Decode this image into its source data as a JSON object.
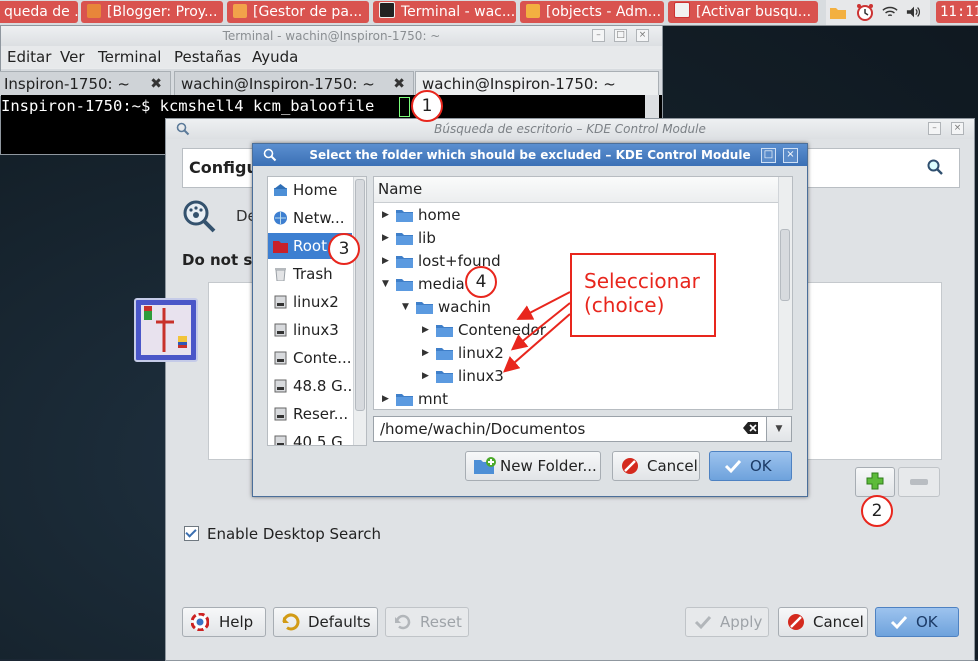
{
  "taskbar": {
    "tasks": [
      {
        "label": "queda de ...",
        "icon": "browser-icon"
      },
      {
        "label": "[Blogger: Proy...",
        "icon": "blogger-icon"
      },
      {
        "label": "[Gestor de pa...",
        "icon": "package-manager-icon"
      },
      {
        "label": "Terminal - wac...",
        "icon": "terminal-icon"
      },
      {
        "label": "[objects - Adm...",
        "icon": "folder-icon"
      },
      {
        "label": "[Activar busqu...",
        "icon": "document-icon"
      }
    ],
    "clock": "11:11",
    "tray_icons": [
      "folder-icon",
      "alarm-clock-icon",
      "wifi-icon",
      "volume-icon"
    ]
  },
  "terminal": {
    "title": "Terminal - wachin@Inspiron-1750: ~",
    "menu": [
      "Editar",
      "Ver",
      "Terminal",
      "Pestañas",
      "Ayuda"
    ],
    "tabs": [
      "Inspiron-1750: ~",
      "wachin@Inspiron-1750: ~",
      "wachin@Inspiron-1750: ~"
    ],
    "prompt": "Inspiron-1750:~$ ",
    "command": "kcmshell4 kcm_baloofile"
  },
  "kcm": {
    "title": "Búsqueda de escritorio – KDE Control Module",
    "header": "Configur",
    "description": "De",
    "do_not_search": "Do not se",
    "enable_search": "Enable Desktop Search",
    "buttons": {
      "help": "Help",
      "defaults": "Defaults",
      "reset": "Reset",
      "apply": "Apply",
      "cancel": "Cancel",
      "ok": "OK"
    }
  },
  "dialog": {
    "title": "Select the folder which should be excluded – KDE Control Module",
    "places": [
      {
        "label": "Home",
        "icon": "home-icon",
        "selected": false
      },
      {
        "label": "Netw...",
        "icon": "network-icon",
        "selected": false
      },
      {
        "label": "Root",
        "icon": "root-folder-icon",
        "selected": true
      },
      {
        "label": "Trash",
        "icon": "trash-icon",
        "selected": false
      },
      {
        "label": "linux2",
        "icon": "drive-icon",
        "selected": false
      },
      {
        "label": "linux3",
        "icon": "drive-icon",
        "selected": false
      },
      {
        "label": "Conte...",
        "icon": "drive-icon",
        "selected": false
      },
      {
        "label": "48.8 G...",
        "icon": "drive-icon",
        "selected": false
      },
      {
        "label": "Reser...",
        "icon": "drive-icon",
        "selected": false
      },
      {
        "label": "40.5 G...",
        "icon": "drive-icon",
        "selected": false
      }
    ],
    "tree_header": "Name",
    "tree": [
      {
        "label": "home",
        "depth": 0,
        "expanded": false
      },
      {
        "label": "lib",
        "depth": 0,
        "expanded": false
      },
      {
        "label": "lost+found",
        "depth": 0,
        "expanded": false
      },
      {
        "label": "media",
        "depth": 0,
        "expanded": true
      },
      {
        "label": "wachin",
        "depth": 1,
        "expanded": true
      },
      {
        "label": "Contenedor",
        "depth": 2,
        "expanded": false
      },
      {
        "label": "linux2",
        "depth": 2,
        "expanded": false
      },
      {
        "label": "linux3",
        "depth": 2,
        "expanded": false
      },
      {
        "label": "mnt",
        "depth": 0,
        "expanded": false
      }
    ],
    "path_value": "/home/wachin/Documentos",
    "buttons": {
      "new_folder": "New Folder...",
      "cancel": "Cancel",
      "ok": "OK"
    }
  },
  "annotations": {
    "badges": [
      "1",
      "2",
      "3",
      "4"
    ],
    "callout": "Seleccionar\n(choice)"
  },
  "colors": {
    "accent": "#3d7fd1",
    "taskbar_task": "#d9534f",
    "annotation_red": "#e8261d",
    "primary_button": "#6ea2dc"
  }
}
